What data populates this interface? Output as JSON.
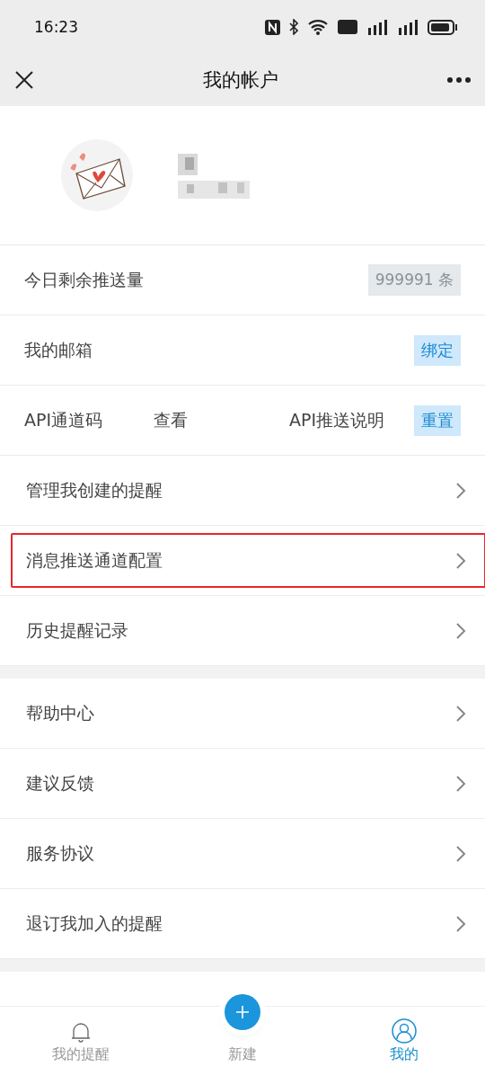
{
  "status_bar": {
    "time": "16:23"
  },
  "nav": {
    "title": "我的帐户"
  },
  "account_rows": [
    {
      "kind": "count",
      "label": "今日剩余推送量",
      "value": "999991 条"
    },
    {
      "kind": "action",
      "label": "我的邮箱",
      "action": "绑定"
    },
    {
      "kind": "api",
      "label": "API通道码",
      "view": "查看",
      "doc": "API推送说明",
      "action": "重置"
    }
  ],
  "menu_groups": [
    [
      {
        "label": "管理我创建的提醒",
        "highlighted": false
      },
      {
        "label": "消息推送通道配置",
        "highlighted": true
      },
      {
        "label": "历史提醒记录",
        "highlighted": false
      }
    ],
    [
      {
        "label": "帮助中心",
        "highlighted": false
      },
      {
        "label": "建议反馈",
        "highlighted": false
      },
      {
        "label": "服务协议",
        "highlighted": false
      },
      {
        "label": "退订我加入的提醒",
        "highlighted": false
      }
    ]
  ],
  "tabs": [
    {
      "kind": "bell",
      "label": "我的提醒",
      "selected": false
    },
    {
      "kind": "add",
      "label": "新建",
      "selected": false
    },
    {
      "kind": "person",
      "label": "我的",
      "selected": true
    }
  ]
}
